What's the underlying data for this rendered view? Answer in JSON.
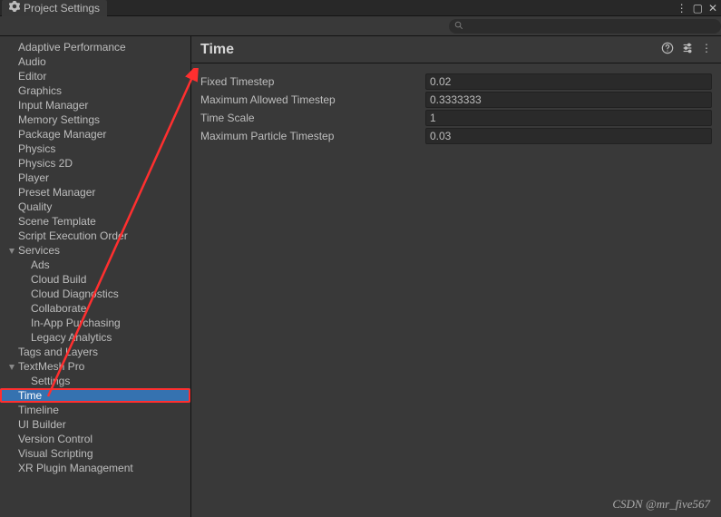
{
  "tab": {
    "title": "Project Settings"
  },
  "sidebar": {
    "items": [
      {
        "label": "Adaptive Performance",
        "level": 0
      },
      {
        "label": "Audio",
        "level": 0
      },
      {
        "label": "Editor",
        "level": 0
      },
      {
        "label": "Graphics",
        "level": 0
      },
      {
        "label": "Input Manager",
        "level": 0
      },
      {
        "label": "Memory Settings",
        "level": 0
      },
      {
        "label": "Package Manager",
        "level": 0
      },
      {
        "label": "Physics",
        "level": 0
      },
      {
        "label": "Physics 2D",
        "level": 0
      },
      {
        "label": "Player",
        "level": 0
      },
      {
        "label": "Preset Manager",
        "level": 0
      },
      {
        "label": "Quality",
        "level": 0
      },
      {
        "label": "Scene Template",
        "level": 0
      },
      {
        "label": "Script Execution Order",
        "level": 0
      },
      {
        "label": "Services",
        "level": 0,
        "expandable": true,
        "expanded": true
      },
      {
        "label": "Ads",
        "level": 1
      },
      {
        "label": "Cloud Build",
        "level": 1
      },
      {
        "label": "Cloud Diagnostics",
        "level": 1
      },
      {
        "label": "Collaborate",
        "level": 1
      },
      {
        "label": "In-App Purchasing",
        "level": 1
      },
      {
        "label": "Legacy Analytics",
        "level": 1
      },
      {
        "label": "Tags and Layers",
        "level": 0
      },
      {
        "label": "TextMesh Pro",
        "level": 0,
        "expandable": true,
        "expanded": true
      },
      {
        "label": "Settings",
        "level": 1
      },
      {
        "label": "Time",
        "level": 0,
        "selected": true
      },
      {
        "label": "Timeline",
        "level": 0
      },
      {
        "label": "UI Builder",
        "level": 0
      },
      {
        "label": "Version Control",
        "level": 0
      },
      {
        "label": "Visual Scripting",
        "level": 0
      },
      {
        "label": "XR Plugin Management",
        "level": 0
      }
    ]
  },
  "main": {
    "title": "Time",
    "props": [
      {
        "label": "Fixed Timestep",
        "value": "0.02"
      },
      {
        "label": "Maximum Allowed Timestep",
        "value": "0.3333333"
      },
      {
        "label": "Time Scale",
        "value": "1"
      },
      {
        "label": "Maximum Particle Timestep",
        "value": "0.03"
      }
    ]
  },
  "watermark": "CSDN @mr_five567"
}
